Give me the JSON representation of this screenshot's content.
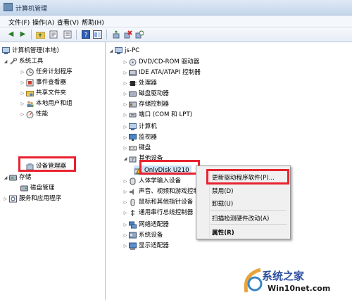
{
  "window": {
    "title": "计算机管理"
  },
  "menu": [
    "文件(F)",
    "操作(A)",
    "查看(V)",
    "帮助(H)"
  ],
  "toolbar_icons": [
    "back-icon",
    "forward-icon",
    "up-folder-icon",
    "properties-icon",
    "list-icon",
    "help-icon",
    "show-pane-icon",
    "refresh-icon",
    "uninstall-icon",
    "update-driver-icon"
  ],
  "left_tree": [
    {
      "label": "计算机管理(本地)",
      "icon": "computer-mgmt-icon"
    },
    {
      "label": "系统工具",
      "icon": "tools-icon"
    },
    {
      "label": "任务计划程序",
      "icon": "clock-icon"
    },
    {
      "label": "事件查看器",
      "icon": "event-viewer-icon"
    },
    {
      "label": "共享文件夹",
      "icon": "shared-folder-icon"
    },
    {
      "label": "本地用户和组",
      "icon": "users-icon"
    },
    {
      "label": "性能",
      "icon": "performance-icon"
    },
    {
      "label": "设备管理器",
      "icon": "device-manager-icon"
    },
    {
      "label": "存储",
      "icon": "storage-icon"
    },
    {
      "label": "磁盘管理",
      "icon": "disk-mgmt-icon"
    },
    {
      "label": "服务和应用程序",
      "icon": "services-icon"
    }
  ],
  "device_tree": {
    "root": "js-PC",
    "categories": [
      {
        "label": "DVD/CD-ROM 驱动器",
        "icon": "dvd-icon"
      },
      {
        "label": "IDE ATA/ATAPI 控制器",
        "icon": "ide-icon"
      },
      {
        "label": "处理器",
        "icon": "cpu-icon"
      },
      {
        "label": "磁盘驱动器",
        "icon": "disk-icon"
      },
      {
        "label": "存储控制器",
        "icon": "storage-controller-icon"
      },
      {
        "label": "端口 (COM 和 LPT)",
        "icon": "port-icon"
      },
      {
        "label": "计算机",
        "icon": "computer-icon"
      },
      {
        "label": "监视器",
        "icon": "monitor-icon"
      },
      {
        "label": "键盘",
        "icon": "keyboard-icon"
      },
      {
        "label": "其他设备",
        "icon": "other-devices-icon"
      },
      {
        "label": "OnlyDisk U210",
        "icon": "warning-device-icon"
      },
      {
        "label": "人体学输入设备",
        "icon": "hid-icon"
      },
      {
        "label": "声音、视频和游戏控制器",
        "icon": "sound-icon"
      },
      {
        "label": "鼠标和其他指针设备",
        "icon": "mouse-icon"
      },
      {
        "label": "通用串行总线控制器",
        "icon": "usb-icon"
      },
      {
        "label": "网络适配器",
        "icon": "network-icon"
      },
      {
        "label": "系统设备",
        "icon": "system-device-icon"
      },
      {
        "label": "显示适配器",
        "icon": "display-adapter-icon"
      }
    ]
  },
  "context_menu": [
    "更新驱动程序软件(P)...",
    "禁用(D)",
    "卸载(U)",
    "扫描检测硬件改动(A)",
    "属性(R)"
  ],
  "watermark": {
    "brand": "系统之家",
    "url": "Win10net.com"
  },
  "colors": {
    "highlight_box": "#e8232f",
    "selection": "#cce4f7"
  }
}
